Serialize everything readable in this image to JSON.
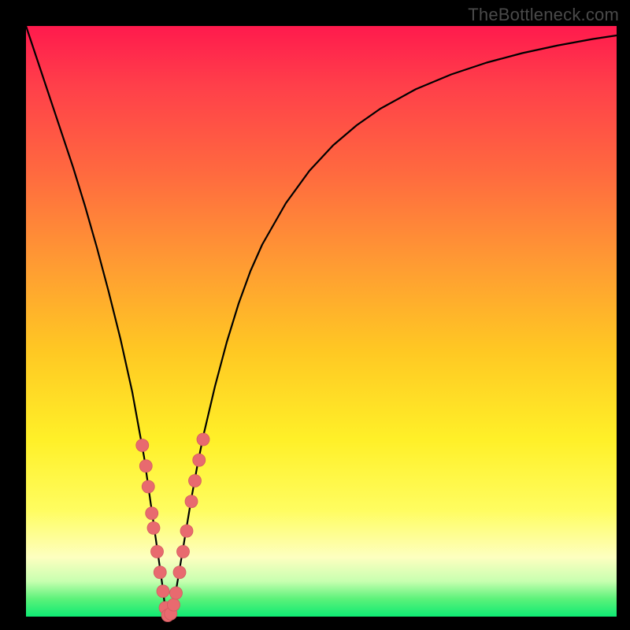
{
  "watermark": "TheBottleneck.com",
  "colors": {
    "frame": "#000000",
    "curve_stroke": "#000000",
    "marker_fill": "#e86a6f",
    "marker_stroke": "#d35b60"
  },
  "chart_data": {
    "type": "line",
    "title": "",
    "xlabel": "",
    "ylabel": "",
    "xlim": [
      0,
      100
    ],
    "ylim": [
      0,
      100
    ],
    "grid": false,
    "legend": false,
    "series": [
      {
        "name": "curve",
        "x": [
          0,
          2,
          4,
          6,
          8,
          10,
          12,
          14,
          16,
          18,
          20,
          21,
          22,
          23,
          23.5,
          24,
          25,
          26,
          27,
          28,
          29,
          30,
          32,
          34,
          36,
          38,
          40,
          44,
          48,
          52,
          56,
          60,
          66,
          72,
          78,
          84,
          90,
          96,
          100
        ],
        "y": [
          100,
          94,
          88,
          82,
          76,
          69.5,
          62.5,
          55,
          47,
          38,
          27,
          20,
          13,
          6,
          2,
          0,
          2,
          8,
          14,
          20,
          25.5,
          30.5,
          39,
          46.5,
          53,
          58.5,
          63,
          70,
          75.5,
          79.8,
          83.2,
          86,
          89.3,
          91.8,
          93.8,
          95.4,
          96.7,
          97.8,
          98.4
        ]
      }
    ],
    "markers": [
      {
        "x": 19.7,
        "y": 29.0
      },
      {
        "x": 20.3,
        "y": 25.5
      },
      {
        "x": 20.7,
        "y": 22.0
      },
      {
        "x": 21.3,
        "y": 17.5
      },
      {
        "x": 21.6,
        "y": 15.0
      },
      {
        "x": 22.2,
        "y": 11.0
      },
      {
        "x": 22.7,
        "y": 7.5
      },
      {
        "x": 23.2,
        "y": 4.3
      },
      {
        "x": 23.6,
        "y": 1.5
      },
      {
        "x": 24.0,
        "y": 0.2
      },
      {
        "x": 24.5,
        "y": 0.5
      },
      {
        "x": 25.0,
        "y": 2.0
      },
      {
        "x": 25.4,
        "y": 4.0
      },
      {
        "x": 26.0,
        "y": 7.5
      },
      {
        "x": 26.6,
        "y": 11.0
      },
      {
        "x": 27.2,
        "y": 14.5
      },
      {
        "x": 28.0,
        "y": 19.5
      },
      {
        "x": 28.6,
        "y": 23.0
      },
      {
        "x": 29.3,
        "y": 26.5
      },
      {
        "x": 30.0,
        "y": 30.0
      }
    ]
  }
}
